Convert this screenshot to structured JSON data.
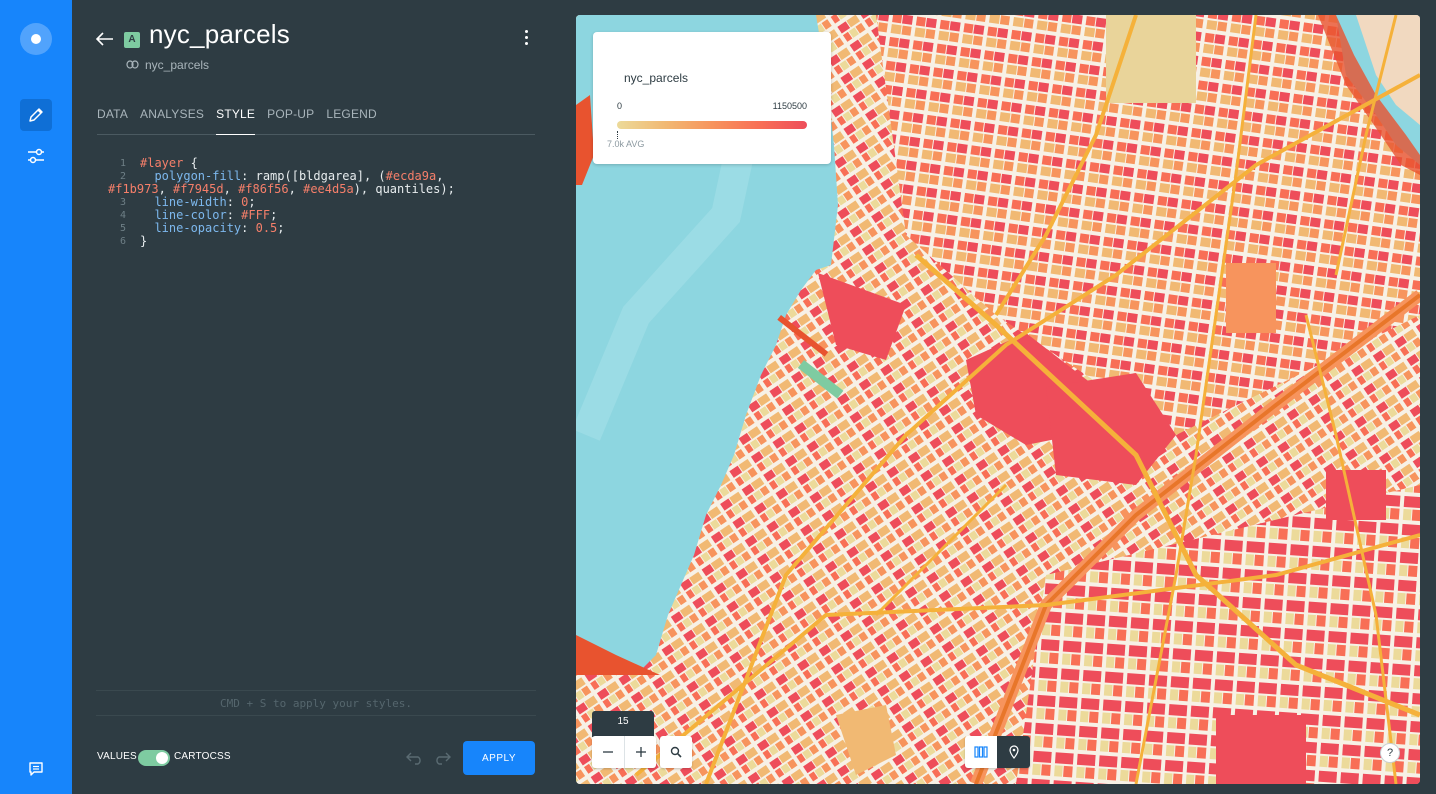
{
  "layer": {
    "badge": "A",
    "title": "nyc_parcels",
    "source": "nyc_parcels"
  },
  "tabs": [
    {
      "label": "DATA",
      "active": false
    },
    {
      "label": "ANALYSES",
      "active": false
    },
    {
      "label": "STYLE",
      "active": true
    },
    {
      "label": "POP-UP",
      "active": false
    },
    {
      "label": "LEGEND",
      "active": false
    }
  ],
  "editor": {
    "line_numbers": [
      "1",
      "2",
      "",
      "3",
      "4",
      "5",
      "6"
    ],
    "lines": {
      "l1_sel": "#layer",
      "l1_brace": " {",
      "l2_indent": "  ",
      "l2_prop": "polygon-fill",
      "l2_a": ": ramp([bldgarea], (",
      "l2_c1": "#ecda9a",
      "l2_sep1": ",",
      "l2b_c2": "#f1b973",
      "l2b_sep2": ", ",
      "l2b_c3": "#f7945d",
      "l2b_sep3": ", ",
      "l2b_c4": "#f86f56",
      "l2b_sep4": ", ",
      "l2b_c5": "#ee4d5a",
      "l2b_end": "), quantiles);",
      "l3_prop": "line-width",
      "l3_colon": ": ",
      "l3_val": "0",
      "l3_semi": ";",
      "l4_prop": "line-color",
      "l4_colon": ": ",
      "l4_val": "#FFF",
      "l4_semi": ";",
      "l5_prop": "line-opacity",
      "l5_colon": ": ",
      "l5_val": "0.5",
      "l5_semi": ";",
      "l6": "}"
    },
    "hint": "CMD + S to apply your styles."
  },
  "footer": {
    "values_label": "VALUES",
    "cartocss_label": "CARTOCSS",
    "apply_label": "APPLY"
  },
  "legend": {
    "title": "nyc_parcels",
    "min": "0",
    "max": "1150500",
    "avg": "7.0k AVG",
    "ramp": [
      "#ecda9a",
      "#f1b973",
      "#f7945d",
      "#f86f56",
      "#ee4d5a"
    ]
  },
  "map": {
    "zoom": "15",
    "help": "?"
  },
  "colors": {
    "brand": "#1785fb",
    "panel": "#2e3c43",
    "toggle_on": "#7ecba1",
    "water": "#8dd6e0"
  },
  "icons": {
    "back": "arrow-left-icon",
    "kebab": "kebab-menu-icon",
    "source": "link-icon",
    "edit": "pencil-icon",
    "settings": "sliders-icon",
    "feedback": "chat-icon",
    "undo": "undo-icon",
    "redo": "redo-icon",
    "zoom_out": "minus-icon",
    "zoom_in": "plus-icon",
    "search": "search-icon",
    "basemap": "basemap-icon",
    "pin": "pin-icon"
  }
}
